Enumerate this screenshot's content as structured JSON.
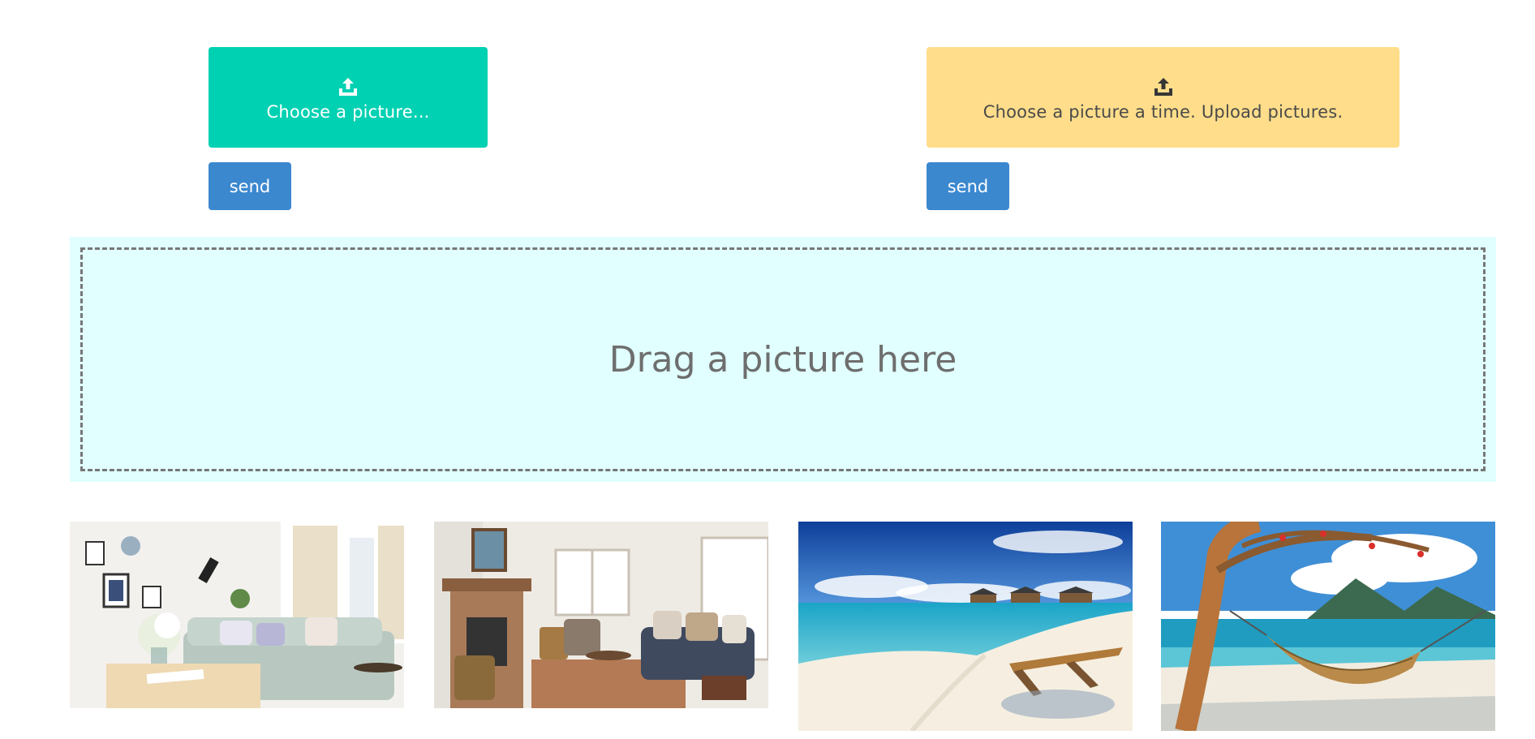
{
  "upload_single": {
    "icon": "upload-icon",
    "label": "Choose a picture...",
    "color": "#00d1b2",
    "send_label": "send"
  },
  "upload_multiple": {
    "icon": "upload-icon",
    "label": "Choose a picture a time. Upload pictures.",
    "color": "#ffdd8a",
    "send_label": "send"
  },
  "dropzone": {
    "text": "Drag a picture here",
    "background": "#e0fffe"
  },
  "gallery": [
    {
      "name": "living-room-white-sofa-photo"
    },
    {
      "name": "living-room-fireplace-photo"
    },
    {
      "name": "beach-lounge-chair-photo"
    },
    {
      "name": "beach-hammock-photo"
    }
  ],
  "button_color": "#3b88cf"
}
